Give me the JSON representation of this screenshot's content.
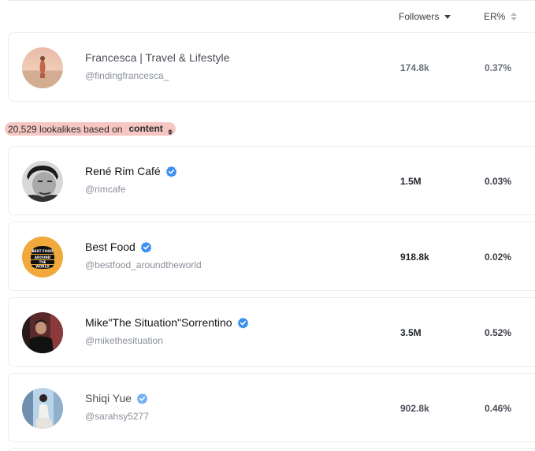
{
  "columns": {
    "followers_label": "Followers",
    "er_label": "ER%"
  },
  "seed": {
    "name": "Francesca | Travel & Lifestyle",
    "handle": "@findingfrancesca_",
    "followers": "174.8k",
    "er": "0.37%"
  },
  "lookalikes": {
    "count_text": "20,529 lookalikes based on",
    "basis": "content"
  },
  "results": [
    {
      "name": "René Rim Café",
      "handle": "@rimcafe",
      "followers": "1.5M",
      "er": "0.03%",
      "verified": true
    },
    {
      "name": "Best Food",
      "handle": "@bestfood_aroundtheworld",
      "followers": "918.8k",
      "er": "0.02%",
      "verified": true,
      "avatar_text": "BEST FOOD AROUND THE WORLD"
    },
    {
      "name": "Mike\"The Situation\"Sorrentino",
      "handle": "@mikethesituation",
      "followers": "3.5M",
      "er": "0.52%",
      "verified": true
    },
    {
      "name": "Shiqi Yue",
      "handle": "@sarahsy5277",
      "followers": "902.8k",
      "er": "0.46%",
      "verified": true
    }
  ],
  "colors": {
    "verified_blue": "#3b8ff0",
    "highlight": "#f6c6c2",
    "bestfood_orange": "#f2a93b"
  }
}
